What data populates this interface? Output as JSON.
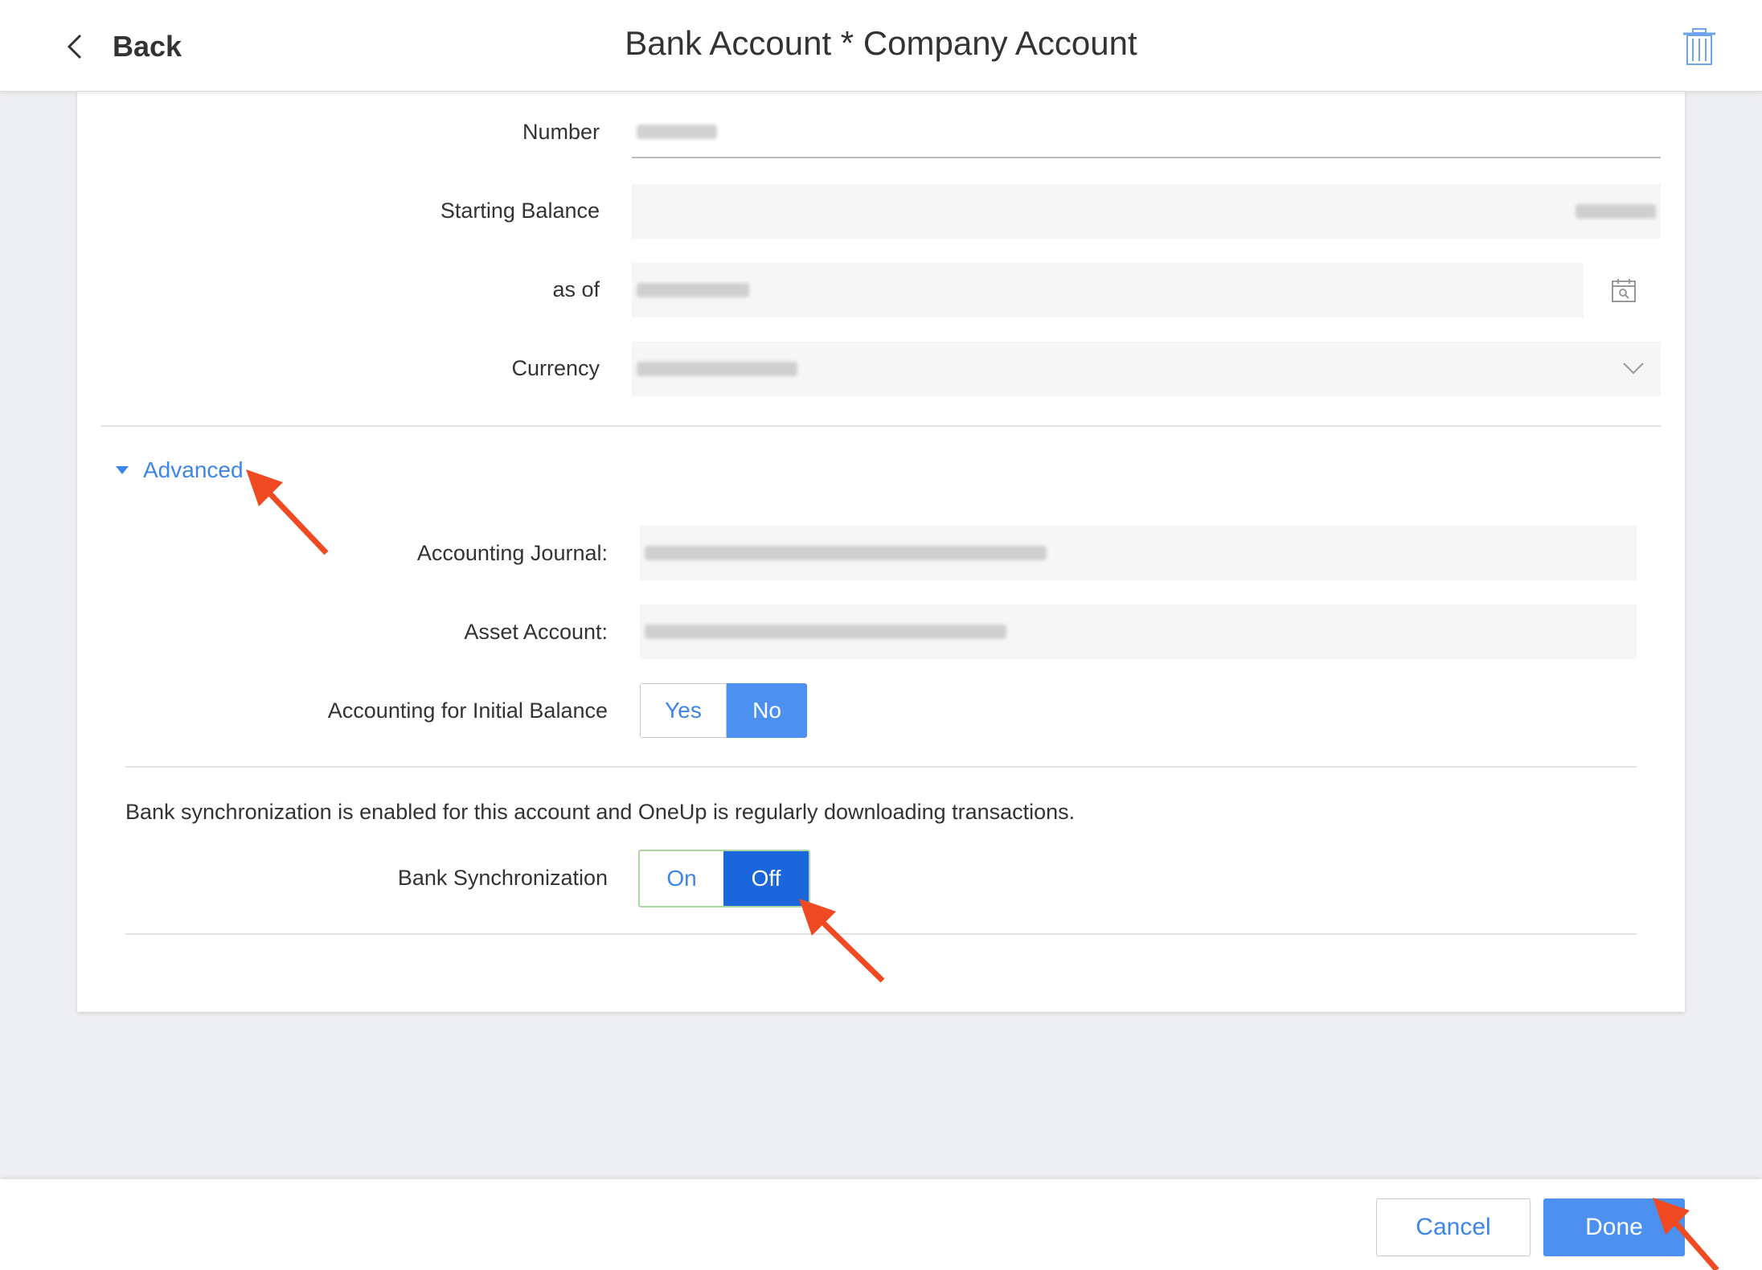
{
  "header": {
    "back_label": "Back",
    "title": "Bank Account * Company Account",
    "back_icon": "chevron-left-icon",
    "delete_icon": "trash-icon"
  },
  "form": {
    "number_label": "Number",
    "starting_balance_label": "Starting Balance",
    "as_of_label": "as of",
    "currency_label": "Currency",
    "calendar_icon": "calendar-icon",
    "dropdown_icon": "chevron-down-icon"
  },
  "advanced": {
    "toggle_label": "Advanced",
    "accounting_journal_label": "Accounting Journal:",
    "asset_account_label": "Asset Account:",
    "initial_balance_label": "Accounting for Initial Balance",
    "initial_balance_options": [
      "Yes",
      "No"
    ],
    "initial_balance_selected": "No"
  },
  "sync": {
    "note": "Bank synchronization is enabled for this account and OneUp is regularly downloading transactions.",
    "label": "Bank Synchronization",
    "options": [
      "On",
      "Off"
    ],
    "selected": "Off"
  },
  "footer": {
    "cancel_label": "Cancel",
    "done_label": "Done"
  },
  "colors": {
    "accent": "#3d86e8",
    "selected": "#4c91f0",
    "selected_dark": "#1a66da",
    "annotation_arrow": "#f04a23"
  }
}
